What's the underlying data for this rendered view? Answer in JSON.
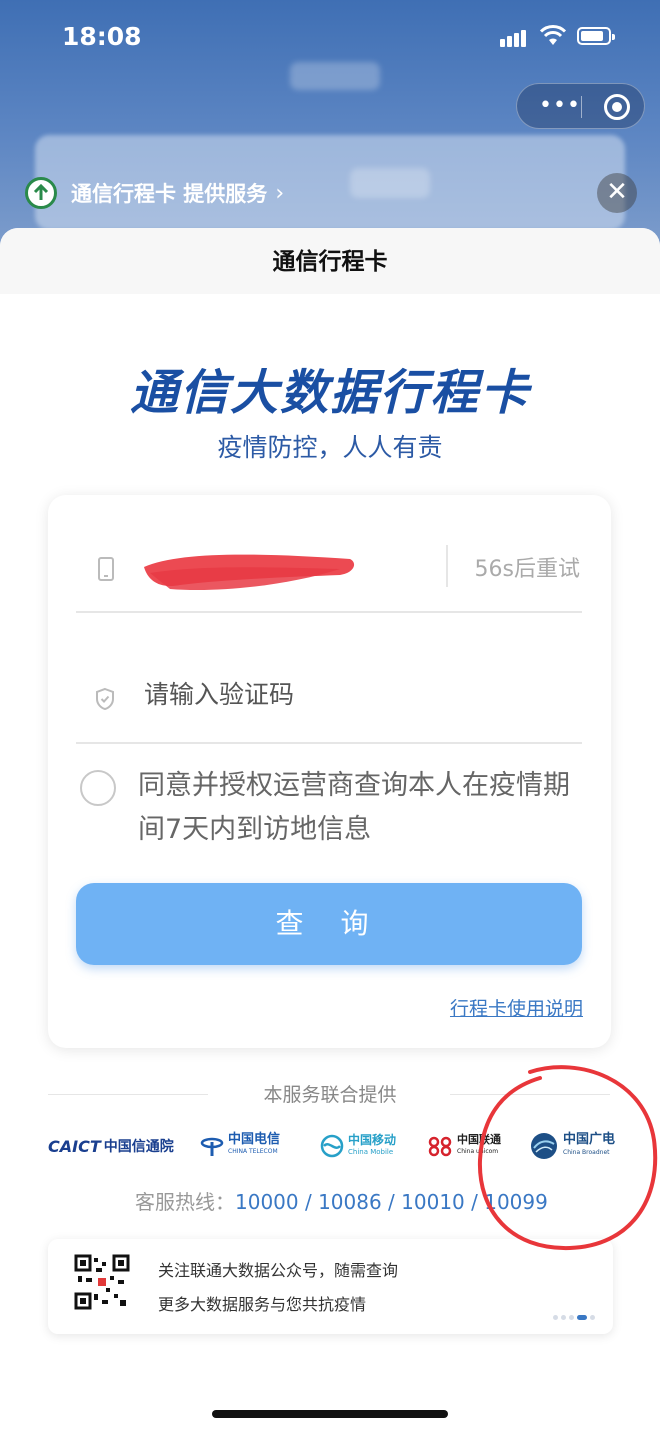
{
  "status": {
    "time": "18:08"
  },
  "provider_bar": {
    "label": "通信行程卡 提供服务",
    "chevron": "›",
    "close": "✕"
  },
  "capsule": {
    "more": "•••"
  },
  "sheet": {
    "header_title": "通信行程卡"
  },
  "main": {
    "title": "通信大数据行程卡",
    "subtitle": "疫情防控，人人有责",
    "phone": {
      "value": "",
      "retry_label": "56s后重试"
    },
    "code": {
      "placeholder": "请输入验证码"
    },
    "agree_text": "同意并授权运营商查询本人在疫情期间7天内到访地信息",
    "query_button": "查 询",
    "help_link": "行程卡使用说明"
  },
  "footer": {
    "joint_label": "本服务联合提供",
    "logos": {
      "caict": "CAICT",
      "caict_cn": "中国信通院",
      "telecom_cn": "中国电信",
      "telecom_en": "CHINA TELECOM",
      "mobile_cn": "中国移动",
      "mobile_en": "China Mobile",
      "unicom_cn": "中国联通",
      "unicom_en": "China unicom",
      "broadnet_cn": "中国广电",
      "broadnet_en": "China Broadnet"
    },
    "hotline_label": "客服热线：",
    "hotline_numbers": "10000 / 10086 / 10010 / 10099"
  },
  "promo": {
    "line1": "关注联通大数据公众号，随需查询",
    "line2": "更多大数据服务与您共抗疫情"
  },
  "colors": {
    "brand_blue": "#1a4fa3",
    "button_blue": "#6fb2f4",
    "link_blue": "#3a78c4",
    "annotation_red": "#e8363a"
  }
}
